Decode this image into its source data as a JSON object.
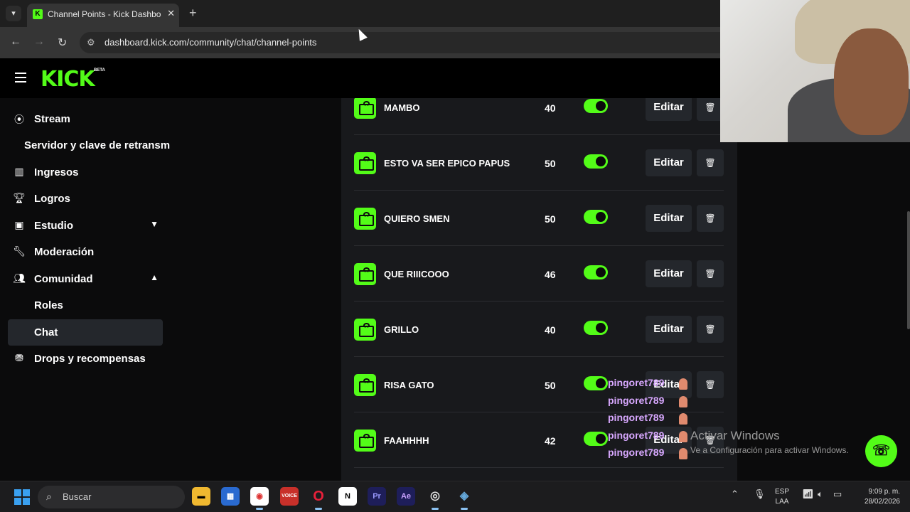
{
  "browser": {
    "tab_title": "Channel Points - Kick Dashboard",
    "tab_favicon": "K",
    "url": "dashboard.kick.com/community/chat/channel-points"
  },
  "header": {
    "logo": "KICK",
    "beta": "BETA"
  },
  "sidebar": {
    "items": [
      {
        "label": "Stream",
        "icon": "broadcast-icon"
      },
      {
        "label": "Servidor y clave de retransm"
      },
      {
        "label": "Ingresos",
        "icon": "chart-icon"
      },
      {
        "label": "Logros",
        "icon": "trophy-icon"
      },
      {
        "label": "Estudio",
        "icon": "studio-icon"
      },
      {
        "label": "Moderación",
        "icon": "wrench-icon"
      },
      {
        "label": "Comunidad",
        "icon": "users-icon"
      },
      {
        "label": "Roles"
      },
      {
        "label": "Chat"
      },
      {
        "label": "Drops y recompensas",
        "icon": "drops-icon"
      }
    ]
  },
  "rewards": [
    {
      "name": "MAMBO",
      "cost": "40",
      "enabled": true
    },
    {
      "name": "ESTO VA SER EPICO PAPUS",
      "cost": "50",
      "enabled": true
    },
    {
      "name": "QUIERO SMEN",
      "cost": "50",
      "enabled": true
    },
    {
      "name": "QUE RIIICOOO",
      "cost": "46",
      "enabled": true
    },
    {
      "name": "GRILLO",
      "cost": "40",
      "enabled": true
    },
    {
      "name": "RISA GATO",
      "cost": "50",
      "enabled": true
    },
    {
      "name": "FAAHHHH",
      "cost": "42",
      "enabled": true
    }
  ],
  "edit_label": "Editar",
  "chat_overlay": [
    "pingoret789",
    "pingoret789",
    "pingoret789",
    "pingoret789",
    "pingoret789"
  ],
  "watermark": {
    "title": "Activar Windows",
    "subtitle": "Ve a Configuración para activar Windows."
  },
  "taskbar": {
    "search_placeholder": "Buscar",
    "lang_line1": "ESP",
    "lang_line2": "LAA",
    "time": "9:09 p. m.",
    "date": "28/02/2026"
  },
  "colors": {
    "accent": "#53fc18",
    "panel": "#18191c",
    "background": "#0b0b0c"
  }
}
